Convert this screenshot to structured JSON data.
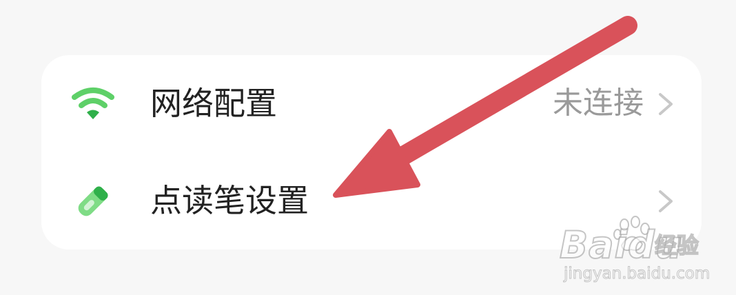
{
  "settings": {
    "rows": [
      {
        "label": "网络配置",
        "value": "未连接",
        "icon": "wifi-icon"
      },
      {
        "label": "点读笔设置",
        "value": "",
        "icon": "pen-icon"
      }
    ]
  },
  "colors": {
    "icon_green": "#5ed068",
    "annotation_arrow": "#d9525a",
    "chevron": "#c8c8c8"
  },
  "watermark": {
    "logo": "Baidu",
    "sub": "经验",
    "url": "jingyan.baidu.com"
  }
}
